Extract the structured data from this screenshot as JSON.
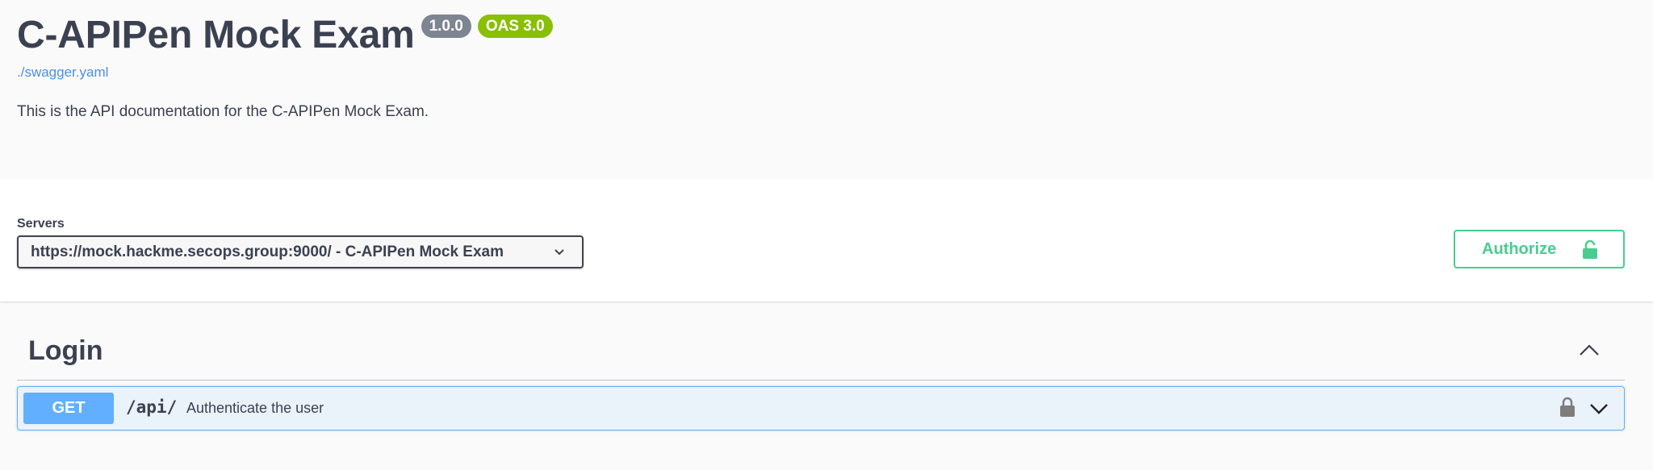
{
  "info": {
    "title": "C-APIPen Mock Exam",
    "version_badge": "1.0.0",
    "oas_badge": "OAS 3.0",
    "spec_link": "./swagger.yaml",
    "description": "This is the API documentation for the C-APIPen Mock Exam."
  },
  "servers": {
    "label": "Servers",
    "selected": "https://mock.hackme.secops.group:9000/ - C-APIPen Mock Exam",
    "dropdown_icon": "chevron-down-icon"
  },
  "authorize": {
    "label": "Authorize",
    "icon": "unlocked-icon"
  },
  "tags": [
    {
      "name": "Login",
      "collapse_icon": "chevron-up-icon",
      "operations": [
        {
          "method": "GET",
          "path": "/api/",
          "summary": "Authenticate the user",
          "lock_icon": "locked-icon",
          "expand_icon": "chevron-down-icon"
        }
      ]
    }
  ],
  "colors": {
    "get": "#61affe",
    "authorize": "#49cc90",
    "oas_badge": "#89bf04",
    "version_badge": "#7d8492",
    "link": "#4990e2",
    "text": "#3b4151"
  }
}
